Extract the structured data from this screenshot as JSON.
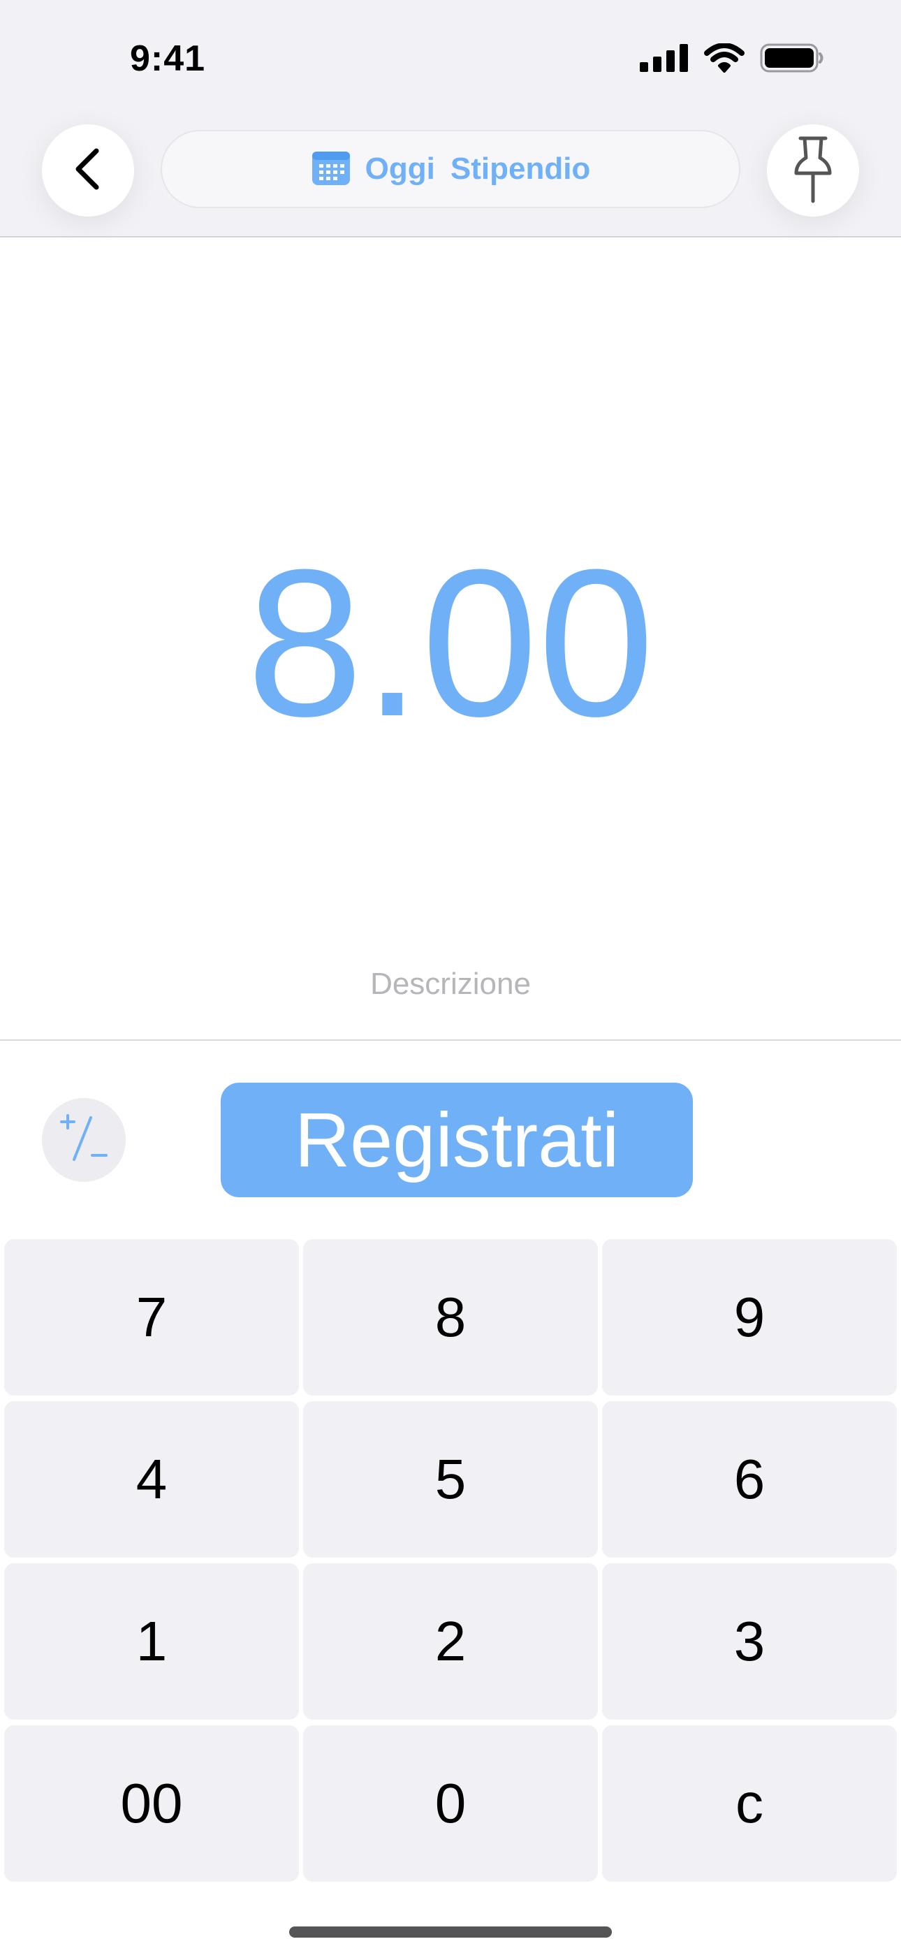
{
  "status_bar": {
    "time": "9:41",
    "icons": [
      "cellular-signal-icon",
      "wifi-icon",
      "battery-icon"
    ]
  },
  "header": {
    "back_icon": "chevron-left-icon",
    "pin_icon": "pushpin-icon",
    "calendar_icon": "calendar-icon",
    "date_label": "Oggi",
    "category_label": "Stipendio"
  },
  "amount": {
    "value": "8.00"
  },
  "description": {
    "placeholder": "Descrizione"
  },
  "actions": {
    "sign_toggle_label": "+/−",
    "register_label": "Registrati"
  },
  "keypad": {
    "keys": [
      "7",
      "8",
      "9",
      "4",
      "5",
      "6",
      "1",
      "2",
      "3",
      "00",
      "0",
      "c"
    ]
  },
  "colors": {
    "accent": "#6fb0f7",
    "header_bg": "#f2f2f6",
    "key_bg": "#f1f1f5",
    "placeholder": "#b5b5ba"
  }
}
